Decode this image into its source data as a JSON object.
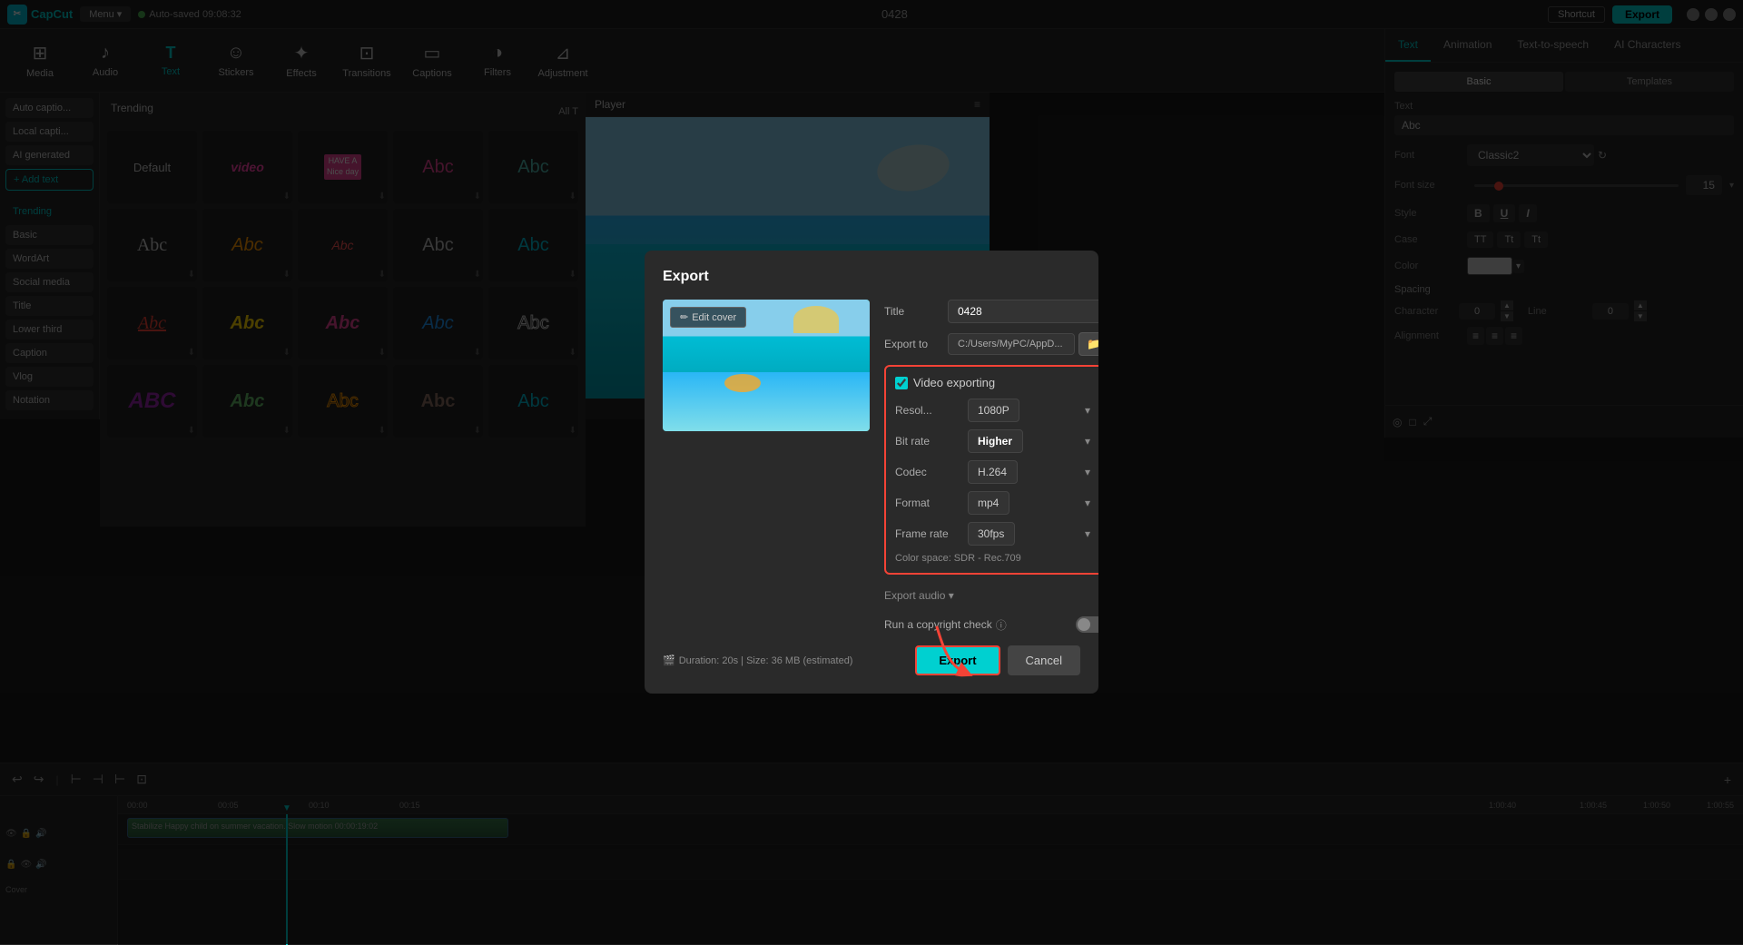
{
  "app": {
    "name": "CapCut",
    "logo_text": "CapCut",
    "menu_label": "Menu",
    "menu_arrow": "▾",
    "autosave": "Auto-saved 09:08:32",
    "title": "0428",
    "shortcut_label": "Shortcut",
    "export_label": "Export"
  },
  "toolbar": {
    "items": [
      {
        "id": "media",
        "label": "Media",
        "icon": "⊞"
      },
      {
        "id": "audio",
        "label": "Audio",
        "icon": "♪"
      },
      {
        "id": "text",
        "label": "Text",
        "icon": "T"
      },
      {
        "id": "stickers",
        "label": "Stickers",
        "icon": "☺"
      },
      {
        "id": "effects",
        "label": "Effects",
        "icon": "✦"
      },
      {
        "id": "transitions",
        "label": "Transitions",
        "icon": "⊡"
      },
      {
        "id": "captions",
        "label": "Captions",
        "icon": "▭"
      },
      {
        "id": "filters",
        "label": "Filters",
        "icon": "◑"
      },
      {
        "id": "adjustment",
        "label": "Adjustment",
        "icon": "⊿"
      }
    ],
    "active": "text"
  },
  "left_panel": {
    "buttons": [
      {
        "id": "auto-caption",
        "label": "Auto captio..."
      },
      {
        "id": "local-caption",
        "label": "Local capti..."
      },
      {
        "id": "ai-generated",
        "label": "AI generated"
      },
      {
        "id": "add-text",
        "label": "+ Add text"
      }
    ],
    "nav_items": [
      {
        "id": "trending",
        "label": "Trending",
        "active": true
      },
      {
        "id": "basic",
        "label": "Basic"
      },
      {
        "id": "wordart",
        "label": "WordArt"
      },
      {
        "id": "social-media",
        "label": "Social media"
      },
      {
        "id": "title",
        "label": "Title"
      },
      {
        "id": "lower-third",
        "label": "Lower third"
      },
      {
        "id": "caption",
        "label": "Caption"
      },
      {
        "id": "vlog",
        "label": "Vlog"
      },
      {
        "id": "notation",
        "label": "Notation"
      }
    ]
  },
  "text_styles": {
    "trending_label": "Trending",
    "all_label": "All T",
    "rows": [
      [
        {
          "id": "default",
          "label": "Default",
          "style": "default",
          "text": "Default"
        },
        {
          "id": "video",
          "label": "",
          "style": "video",
          "text": "video"
        },
        {
          "id": "niceday",
          "label": "",
          "style": "niceday",
          "text": "HAVE A Nice day"
        },
        {
          "id": "abc-pink",
          "label": "",
          "style": "abc1",
          "text": "Abc"
        },
        {
          "id": "abc-teal",
          "label": "",
          "style": "abc2",
          "text": "Abc"
        }
      ],
      [
        {
          "id": "abc-grey",
          "label": "",
          "style": "abc3",
          "text": "Abc"
        },
        {
          "id": "abc-orange",
          "label": "",
          "style": "abc4",
          "text": "Abc"
        },
        {
          "id": "abc-italic",
          "label": "",
          "style": "abc5",
          "text": "Abc"
        },
        {
          "id": "abc-r1",
          "label": "",
          "style": "abc3",
          "text": "Abc"
        },
        {
          "id": "abc-r2",
          "label": "",
          "style": "abc2",
          "text": "Abc"
        }
      ],
      [
        {
          "id": "abc-r3",
          "label": "",
          "style": "abc-red",
          "text": "Abc"
        },
        {
          "id": "abc-r4",
          "label": "",
          "style": "abc-gold",
          "text": "Abc"
        },
        {
          "id": "abc-r5",
          "label": "",
          "style": "abc-pink2",
          "text": "Abc"
        },
        {
          "id": "abc-r6",
          "label": "",
          "style": "abc-blue",
          "text": "Abc"
        },
        {
          "id": "abc-r7",
          "label": "",
          "style": "abc-outlined",
          "text": "Abc"
        }
      ],
      [
        {
          "id": "abc-r8",
          "label": "",
          "style": "abc-purple",
          "text": "ABC"
        },
        {
          "id": "abc-r9",
          "label": "",
          "style": "abc-green",
          "text": "Abc"
        },
        {
          "id": "abc-r10",
          "label": "",
          "style": "abc-outline2",
          "text": "Abc"
        },
        {
          "id": "abc-r11",
          "label": "",
          "style": "abc-brown",
          "text": "Abc"
        },
        {
          "id": "abc-r12",
          "label": "",
          "style": "abc-teal",
          "text": "Abc"
        }
      ]
    ]
  },
  "player": {
    "label": "Player",
    "menu_icon": "≡"
  },
  "right_panel": {
    "tabs": [
      "Text",
      "Animation",
      "Text-to-speech",
      "AI Characters"
    ],
    "active_tab": "Text",
    "sub_tabs": [
      "Basic",
      "Templates"
    ],
    "active_sub": "Basic",
    "text_section_label": "Text",
    "text_value": "Abc",
    "font_label": "Font",
    "font_value": "Classic2",
    "font_size_label": "Font size",
    "font_size_value": "15",
    "style_label": "Style",
    "style_buttons": [
      "B",
      "U",
      "I"
    ],
    "case_label": "Case",
    "case_buttons": [
      "TT",
      "Tt",
      "Tt"
    ],
    "color_label": "Color",
    "spacing_label": "Spacing",
    "character_label": "Character",
    "character_value": "0",
    "line_label": "Line",
    "line_value": "0",
    "alignment_label": "Alignment"
  },
  "timeline": {
    "ruler_marks": [
      "00:00",
      "00:05",
      "00:10",
      "00:15"
    ],
    "tracks": [
      {
        "label": "Stabilize  Happy child on summer vacation. Slow motion  00:00:19:02"
      },
      {
        "label": "Cover"
      }
    ]
  },
  "export_modal": {
    "title": "Export",
    "edit_cover_label": "Edit cover",
    "title_label": "Title",
    "title_value": "0428",
    "export_to_label": "Export to",
    "export_path": "C:/Users/MyPC/AppD...",
    "video_exporting_label": "Video exporting",
    "resolution_label": "Resol...",
    "resolution_value": "1080P",
    "bitrate_label": "Bit rate",
    "bitrate_value": "Higher",
    "codec_label": "Codec",
    "codec_value": "H.264",
    "format_label": "Format",
    "format_value": "mp4",
    "framerate_label": "Frame rate",
    "framerate_value": "30fps",
    "color_space": "Color space: SDR - Rec.709",
    "audio_export_label": "Export audio ▾",
    "copyright_label": "Run a copyright check",
    "duration_label": "Duration: 20s | Size: 36 MB (estimated)",
    "export_button": "Export",
    "cancel_button": "Cancel"
  }
}
